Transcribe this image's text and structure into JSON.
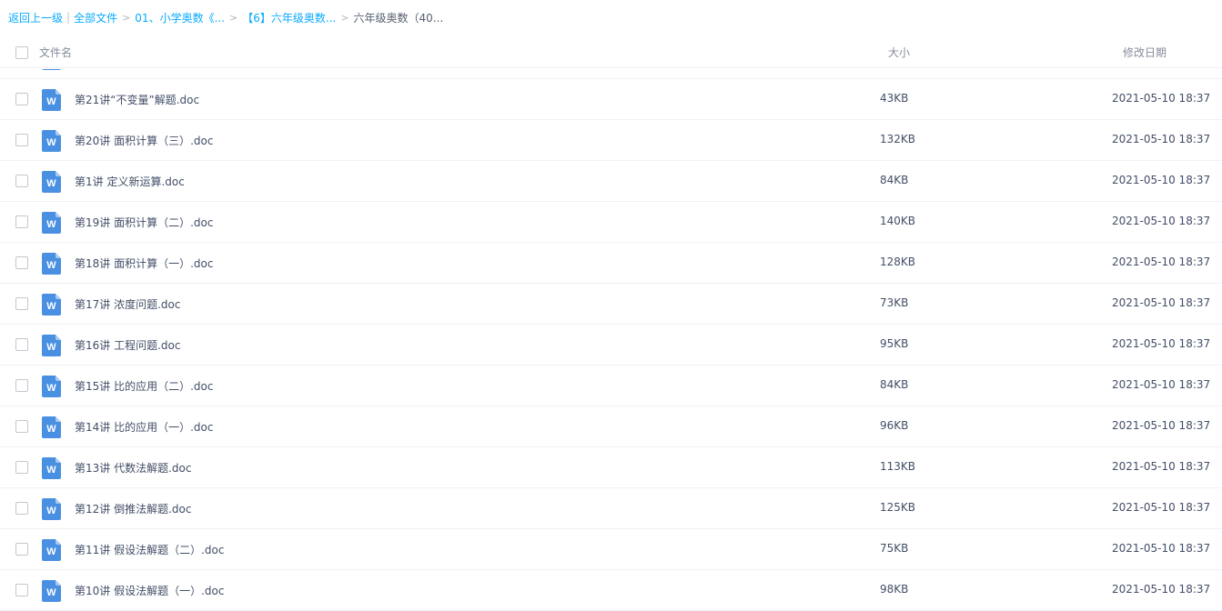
{
  "breadcrumb": {
    "back": "返回上一级",
    "pipe": "|",
    "all_files": "全部文件",
    "sep": ">",
    "crumb1": "01、小学奥数《...",
    "crumb2": "【6】六年级奥数...",
    "current": "六年级奥数（40..."
  },
  "header": {
    "name": "文件名",
    "size": "大小",
    "date": "修改日期"
  },
  "colors": {
    "link": "#09aaff",
    "word_icon": "#4a90e2",
    "text": "#424e67"
  },
  "files": [
    {
      "name": "第21讲“不变量”解题.doc",
      "size": "43KB",
      "date": "2021-05-10 18:37",
      "icon": "word-doc-icon"
    },
    {
      "name": "第20讲 面积计算（三）.doc",
      "size": "132KB",
      "date": "2021-05-10 18:37",
      "icon": "word-doc-icon"
    },
    {
      "name": "第1讲 定义新运算.doc",
      "size": "84KB",
      "date": "2021-05-10 18:37",
      "icon": "word-doc-icon"
    },
    {
      "name": "第19讲 面积计算（二）.doc",
      "size": "140KB",
      "date": "2021-05-10 18:37",
      "icon": "word-doc-icon"
    },
    {
      "name": "第18讲 面积计算（一）.doc",
      "size": "128KB",
      "date": "2021-05-10 18:37",
      "icon": "word-doc-icon"
    },
    {
      "name": "第17讲 浓度问题.doc",
      "size": "73KB",
      "date": "2021-05-10 18:37",
      "icon": "word-doc-icon"
    },
    {
      "name": "第16讲 工程问题.doc",
      "size": "95KB",
      "date": "2021-05-10 18:37",
      "icon": "word-doc-icon"
    },
    {
      "name": "第15讲 比的应用（二）.doc",
      "size": "84KB",
      "date": "2021-05-10 18:37",
      "icon": "word-doc-icon"
    },
    {
      "name": "第14讲 比的应用（一）.doc",
      "size": "96KB",
      "date": "2021-05-10 18:37",
      "icon": "word-doc-icon"
    },
    {
      "name": "第13讲 代数法解题.doc",
      "size": "113KB",
      "date": "2021-05-10 18:37",
      "icon": "word-doc-icon"
    },
    {
      "name": "第12讲 倒推法解题.doc",
      "size": "125KB",
      "date": "2021-05-10 18:37",
      "icon": "word-doc-icon"
    },
    {
      "name": "第11讲 假设法解题（二）.doc",
      "size": "75KB",
      "date": "2021-05-10 18:37",
      "icon": "word-doc-icon"
    },
    {
      "name": "第10讲 假设法解题（一）.doc",
      "size": "98KB",
      "date": "2021-05-10 18:37",
      "icon": "word-doc-icon"
    }
  ]
}
